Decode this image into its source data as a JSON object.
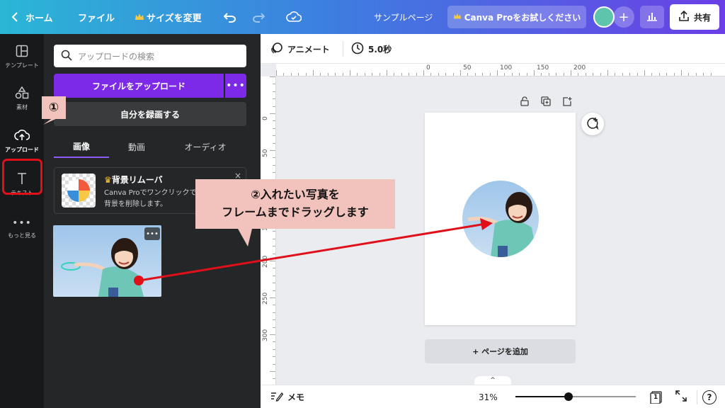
{
  "topbar": {
    "home_label": "ホーム",
    "file_label": "ファイル",
    "resize_label": "サイズを変更",
    "doc_title": "サンプルページ",
    "pro_label": "Canva Proをお試しください",
    "share_label": "共有",
    "gradient_colors": [
      "#2bb6d6",
      "#3d7fe0",
      "#6a3fe6"
    ]
  },
  "leftnav": {
    "items": [
      {
        "label": "テンプレート",
        "icon": "template-icon"
      },
      {
        "label": "素材",
        "icon": "elements-icon"
      },
      {
        "label": "アップロード",
        "icon": "upload-cloud-icon"
      },
      {
        "label": "テキスト",
        "icon": "text-icon"
      },
      {
        "label": "もっと見る",
        "icon": "more-dots-icon"
      }
    ],
    "highlight_color": "#e0101a"
  },
  "panel": {
    "search_placeholder": "アップロードの検索",
    "upload_button": "ファイルをアップロード",
    "upload_more": "•••",
    "record_button": "自分を録画する",
    "tabs": [
      "画像",
      "動画",
      "オーディオ"
    ],
    "active_tab": "画像",
    "promo": {
      "title": "背景リムーバ",
      "text": "Canva Proでワンクリックで背景を削除します。",
      "close": "×"
    },
    "thumb_more": "•••",
    "accent_color": "#7d2ae8"
  },
  "toolbar": {
    "animate_label": "アニメート",
    "duration_label": "5.0秒"
  },
  "canvas": {
    "ruler_h_labels": [
      "0",
      "50",
      "100",
      "150",
      "200"
    ],
    "ruler_v_labels": [
      "0",
      "50",
      "100",
      "150",
      "200",
      "250",
      "300"
    ],
    "add_page_label": "+ ページを追加",
    "collapse_label": "^"
  },
  "bottombar": {
    "notes_label": "メモ",
    "zoom_label": "31%",
    "zoom_fraction": 0.31,
    "page_count": "1",
    "help_label": "?"
  },
  "annotations": {
    "step1": "①",
    "step2_line1": "②入れたい写真を",
    "step2_line2": "フレームまでドラッグします",
    "box_color": "#f2c3bd",
    "arrow_color": "#e0101a"
  }
}
